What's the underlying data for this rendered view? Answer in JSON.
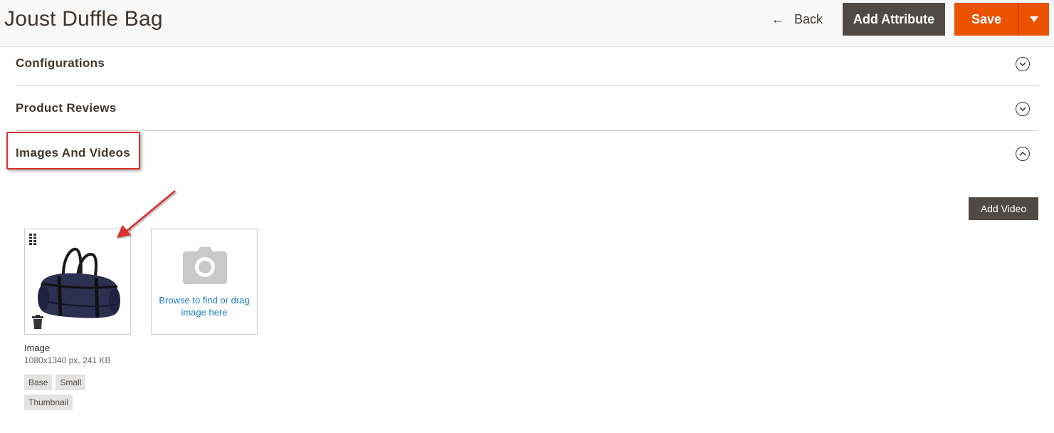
{
  "header": {
    "title": "Joust Duffle Bag",
    "back_label": "Back",
    "add_attribute_label": "Add Attribute",
    "save_label": "Save"
  },
  "sections": [
    {
      "title": "Configurations",
      "state": "collapsed"
    },
    {
      "title": "Product Reviews",
      "state": "collapsed"
    },
    {
      "title": "Images And Videos",
      "state": "expanded"
    }
  ],
  "images_section": {
    "add_video_label": "Add Video",
    "upload_text": "Browse to find or drag image here",
    "image": {
      "label": "Image",
      "meta": "1080x1340 px, 241 KB",
      "roles": [
        "Base",
        "Small",
        "Thumbnail"
      ]
    }
  },
  "colors": {
    "accent": "#eb5202",
    "dark_button": "#514943",
    "link": "#1979c3",
    "highlight": "#d9322f"
  },
  "icons": [
    "back-arrow-icon",
    "chevron-down-icon",
    "chevron-up-icon",
    "drag-handle-icon",
    "trash-icon",
    "camera-icon",
    "caret-down-icon"
  ]
}
